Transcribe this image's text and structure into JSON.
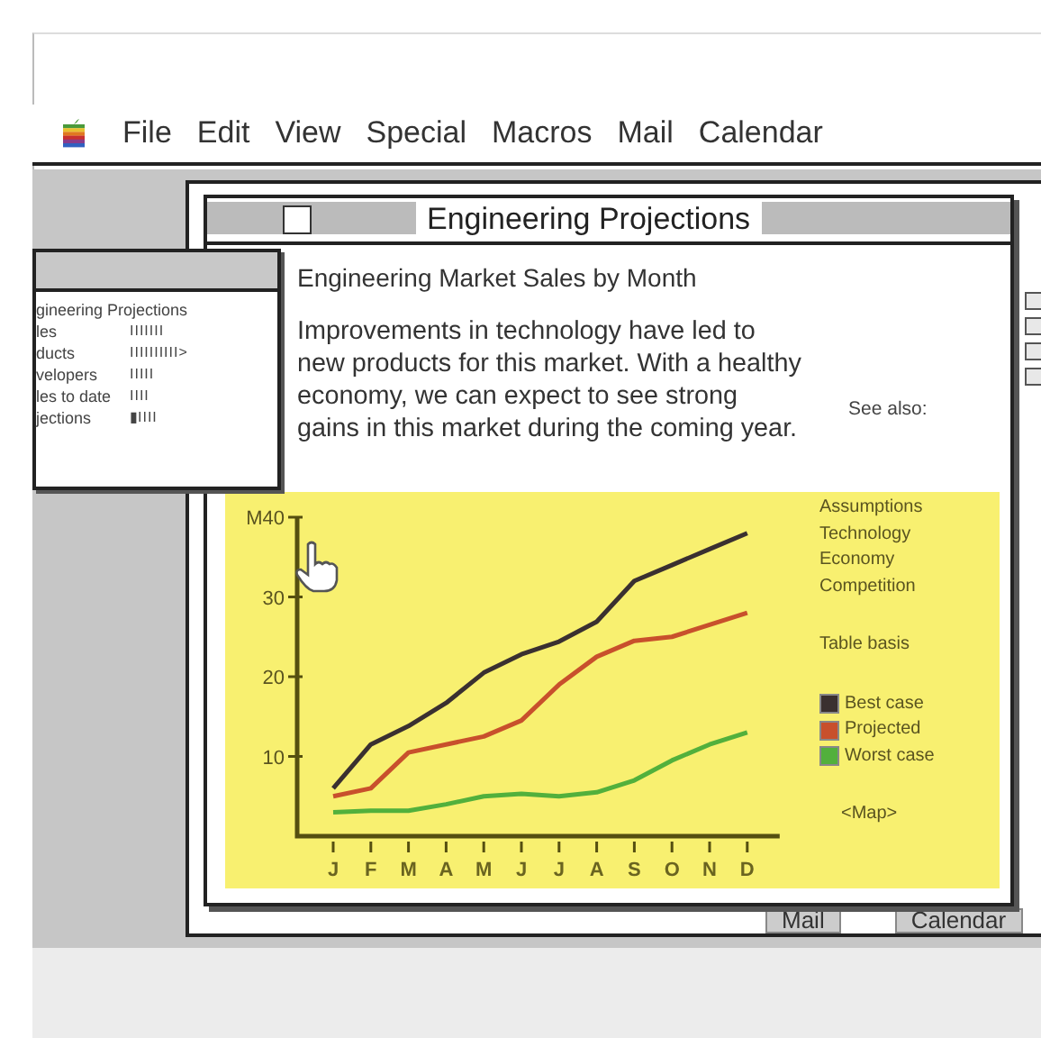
{
  "menubar": {
    "items": [
      "File",
      "Edit",
      "View",
      "Special",
      "Macros",
      "Mail",
      "Calendar"
    ]
  },
  "back_window": {
    "buttons": [
      "Mail",
      "Calendar"
    ]
  },
  "mini_window": {
    "title_line": "gineering Projections",
    "rows": [
      {
        "label": "les",
        "marks": "IIIIIII"
      },
      {
        "label": "ducts",
        "marks": "IIIIIIIIII>"
      },
      {
        "label": "velopers",
        "marks": "IIIII"
      },
      {
        "label": "les to date",
        "marks": "IIII"
      },
      {
        "label": "jections",
        "marks": "▮IIII"
      }
    ]
  },
  "main_window": {
    "title": "Engineering Projections",
    "heading": "Engineering Market Sales by Month",
    "paragraph": "Improvements in technology have led to new products for this market. With a healthy economy, we can expect to see strong gains in this market during the coming year.",
    "see_also_label": "See also:",
    "links": [
      "Assumptions",
      "Technology",
      "Economy",
      "Competition"
    ],
    "table_link": "Table basis",
    "map_link": "<Map>",
    "chart_data": {
      "type": "line",
      "categories": [
        "J",
        "F",
        "M",
        "A",
        "M",
        "J",
        "J",
        "A",
        "S",
        "O",
        "N",
        "D"
      ],
      "yticks": [
        10,
        20,
        30,
        {
          "value": 40,
          "label": "M40"
        }
      ],
      "ylim": [
        0,
        40
      ],
      "series": [
        {
          "name": "Best case",
          "color": "#3a3030",
          "values": [
            6,
            11.5,
            13.8,
            16.7,
            20.5,
            22.8,
            24.4,
            26.9,
            32,
            34,
            36,
            38
          ]
        },
        {
          "name": "Projected",
          "color": "#c8502c",
          "values": [
            5,
            6,
            10.5,
            11.5,
            12.5,
            14.5,
            19,
            22.5,
            24.5,
            25,
            26.5,
            28
          ]
        },
        {
          "name": "Worst case",
          "color": "#52b03c",
          "values": [
            3,
            3.2,
            3.2,
            4,
            5,
            5.3,
            5,
            5.5,
            7,
            9.5,
            11.5,
            13
          ]
        }
      ]
    }
  }
}
